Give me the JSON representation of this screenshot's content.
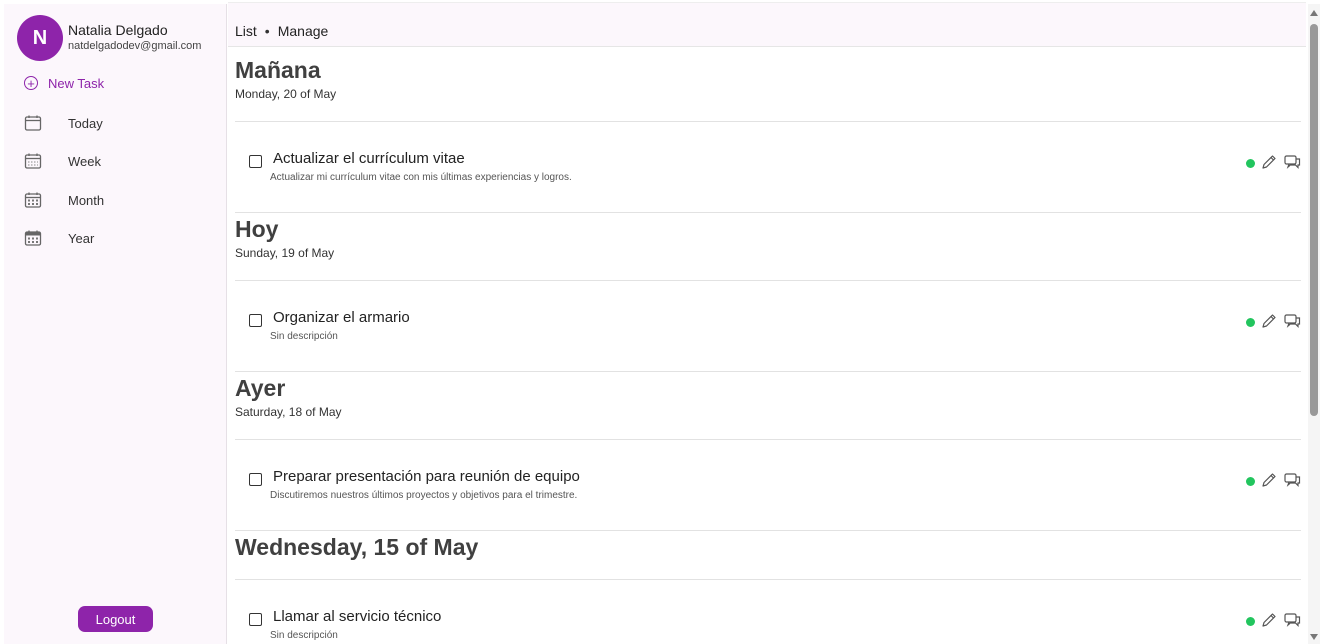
{
  "user": {
    "initial": "N",
    "name": "Natalia Delgado",
    "email": "natdelgadodev@gmail.com"
  },
  "sidebar": {
    "new_task_label": "New Task",
    "nav": [
      {
        "label": "Today",
        "icon": "calendar-empty-icon"
      },
      {
        "label": "Week",
        "icon": "calendar-week-icon"
      },
      {
        "label": "Month",
        "icon": "calendar-month-icon"
      },
      {
        "label": "Year",
        "icon": "calendar-year-icon"
      }
    ],
    "logout_label": "Logout"
  },
  "breadcrumb": {
    "list": "List",
    "separator": "•",
    "manage": "Manage"
  },
  "sections": [
    {
      "title": "Mañana",
      "subtitle": "Monday, 20 of May",
      "tasks": [
        {
          "title": "Actualizar el currículum vitae",
          "description": "Actualizar mi currículum vitae con mis últimas experiencias y logros.",
          "status_color": "#22c55e"
        }
      ]
    },
    {
      "title": "Hoy",
      "subtitle": "Sunday, 19 of May",
      "tasks": [
        {
          "title": "Organizar el armario",
          "description": "Sin descripción",
          "status_color": "#22c55e"
        }
      ]
    },
    {
      "title": "Ayer",
      "subtitle": "Saturday, 18 of May",
      "tasks": [
        {
          "title": "Preparar presentación para reunión de equipo",
          "description": "Discutiremos nuestros últimos proyectos y objetivos para el trimestre.",
          "status_color": "#22c55e"
        }
      ]
    },
    {
      "title": "Wednesday, 15 of May",
      "subtitle": "",
      "tasks": [
        {
          "title": "Llamar al servicio técnico",
          "description": "Sin descripción",
          "status_color": "#22c55e"
        }
      ]
    }
  ],
  "colors": {
    "accent": "#8e24aa",
    "sidebar_bg": "#fcf7fc",
    "status_done": "#22c55e"
  }
}
